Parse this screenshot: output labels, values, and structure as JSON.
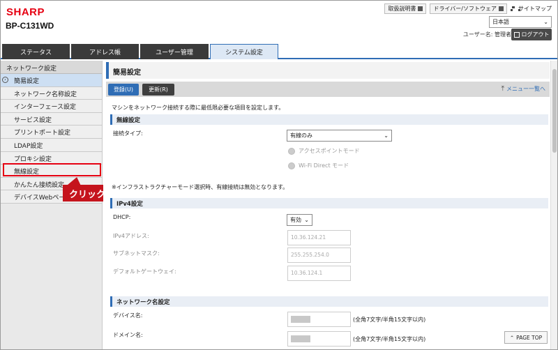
{
  "brand": {
    "logo": "SHARP",
    "model": "BP-C131WD"
  },
  "header": {
    "links": [
      "取扱説明書",
      "ドライバー/ソフトウェア",
      "サイトマップ"
    ],
    "language": "日本語",
    "user_label": "ユーザー名: 管理者",
    "logout_label": "ログアウト"
  },
  "tabs": [
    "ステータス",
    "アドレス帳",
    "ユーザー管理",
    "システム設定"
  ],
  "sidebar": {
    "header": "ネットワーク設定",
    "items": [
      "簡易設定",
      "ネットワーク名称設定",
      "インターフェース設定",
      "サービス設定",
      "プリントポート設定",
      "LDAP設定",
      "プロキシ設定",
      "無線設定",
      "かんたん接続設定",
      "デバイスWebページ"
    ]
  },
  "callout": "クリック",
  "page": {
    "title": "簡易設定",
    "register_button": "登録(U)",
    "refresh_button": "更新(R)",
    "menu_link": "メニュー一覧へ",
    "description": "マシンをネットワーク接続する際に最低限必要な項目を設定します。"
  },
  "wireless": {
    "section": "無線設定",
    "connection_type_label": "接続タイプ:",
    "connection_type_value": "有線のみ",
    "radio_ap": "アクセスポイントモード",
    "radio_wifi_direct": "Wi-Fi Direct モード",
    "note": "※インフラストラクチャーモード選択時、有線接続は無効となります。"
  },
  "ipv4": {
    "section": "IPv4設定",
    "dhcp_label": "DHCP:",
    "dhcp_value": "有効",
    "ip_label": "IPv4アドレス:",
    "ip_value": "10.36.124.21",
    "subnet_label": "サブネットマスク:",
    "subnet_value": "255.255.254.0",
    "gateway_label": "デフォルトゲートウェイ:",
    "gateway_value": "10.36.124.1"
  },
  "network_name": {
    "section": "ネットワーク名設定",
    "device_label": "デバイス名:",
    "device_hint": "(全角7文字/半角15文字以内)",
    "domain_label": "ドメイン名:",
    "domain_hint": "(全角7文字/半角15文字以内)"
  },
  "page_top": "PAGE TOP",
  "colors": {
    "accent": "#2f6db5",
    "brand": "#e60012",
    "callout": "#c5141d"
  }
}
